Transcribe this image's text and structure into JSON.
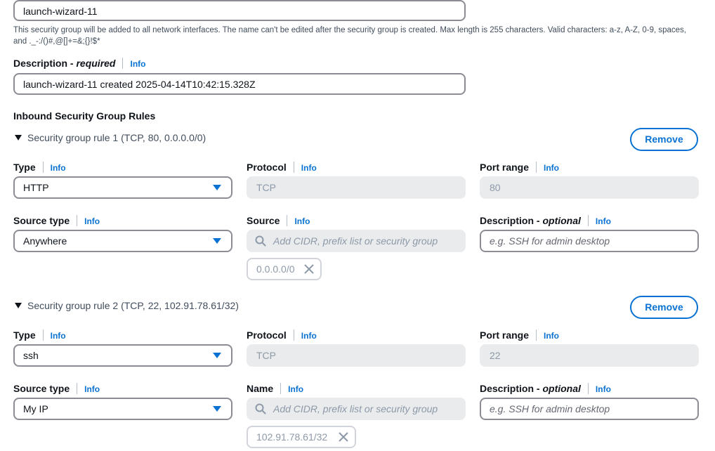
{
  "name_field": {
    "value": "launch-wizard-11",
    "hint": "This security group will be added to all network interfaces. The name can't be edited after the security group is created. Max length is 255 characters. Valid characters: a-z, A-Z, 0-9, spaces, and ._-:/()#,@[]+=&;{}!$*"
  },
  "description_field": {
    "label": "Description - ",
    "required_label": "required",
    "info": "Info",
    "value": "launch-wizard-11 created 2025-04-14T10:42:15.328Z"
  },
  "inbound": {
    "heading": "Inbound Security Group Rules",
    "rules": [
      {
        "title": "Security group rule 1 (TCP, 80, 0.0.0.0/0)",
        "remove_label": "Remove",
        "type_label": "Type",
        "type_value": "HTTP",
        "protocol_label": "Protocol",
        "protocol_value": "TCP",
        "port_label": "Port range",
        "port_value": "80",
        "source_type_label": "Source type",
        "source_type_value": "Anywhere",
        "source_label": "Source",
        "source_placeholder": "Add CIDR, prefix list or security group",
        "source_token": "0.0.0.0/0",
        "desc_label": "Description - ",
        "desc_optional": "optional",
        "desc_placeholder": "e.g. SSH for admin desktop",
        "info": "Info"
      },
      {
        "title": "Security group rule 2 (TCP, 22, 102.91.78.61/32)",
        "remove_label": "Remove",
        "type_label": "Type",
        "type_value": "ssh",
        "protocol_label": "Protocol",
        "protocol_value": "TCP",
        "port_label": "Port range",
        "port_value": "22",
        "source_type_label": "Source type",
        "source_type_value": "My IP",
        "source_label": "Name",
        "source_placeholder": "Add CIDR, prefix list or security group",
        "source_token": "102.91.78.61/32",
        "desc_label": "Description - ",
        "desc_optional": "optional",
        "desc_placeholder": "e.g. SSH for admin desktop",
        "info": "Info"
      }
    ]
  },
  "colors": {
    "link": "#0972d3",
    "border": "#8c8c94",
    "disabled_bg": "#e9ebed"
  },
  "icons": [
    "search-icon",
    "close-icon",
    "caret-down-icon",
    "expand-triangle-icon"
  ]
}
